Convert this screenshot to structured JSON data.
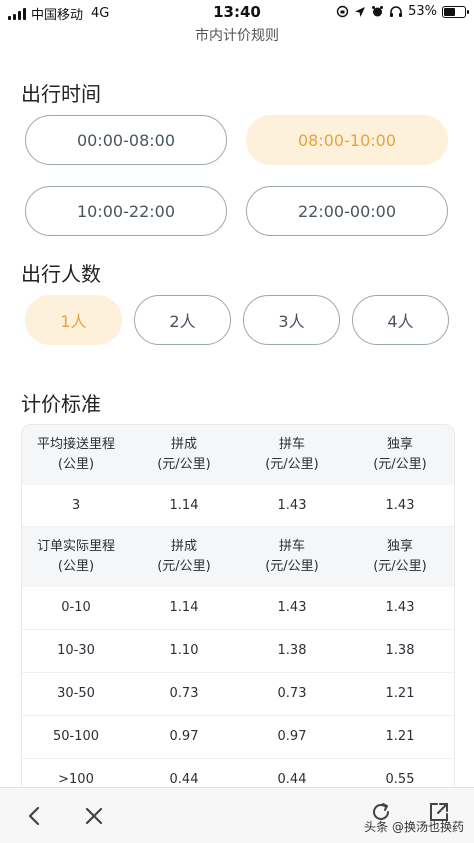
{
  "status_bar": {
    "carrier": "中国移动",
    "network": "4G",
    "time": "13:40",
    "battery": "53%",
    "battery_level": 0.53
  },
  "page": {
    "title": "市内计价规则"
  },
  "travel_time": {
    "title": "出行时间",
    "options": [
      "00:00-08:00",
      "08:00-10:00",
      "10:00-22:00",
      "22:00-00:00"
    ],
    "selected_index": 1
  },
  "passengers": {
    "title": "出行人数",
    "options": [
      "1人",
      "2人",
      "3人",
      "4人"
    ],
    "selected_index": 0
  },
  "pricing": {
    "title": "计价标准",
    "header1": [
      [
        "平均接送里程",
        "(公里)"
      ],
      [
        "拼成",
        "(元/公里)"
      ],
      [
        "拼车",
        "(元/公里)"
      ],
      [
        "独享",
        "(元/公里)"
      ]
    ],
    "row1": [
      "3",
      "1.14",
      "1.43",
      "1.43"
    ],
    "header2": [
      [
        "订单实际里程",
        "(公里)"
      ],
      [
        "拼成",
        "(元/公里)"
      ],
      [
        "拼车",
        "(元/公里)"
      ],
      [
        "独享",
        "(元/公里)"
      ]
    ],
    "rows": [
      [
        "0-10",
        "1.14",
        "1.43",
        "1.43"
      ],
      [
        "10-30",
        "1.10",
        "1.38",
        "1.38"
      ],
      [
        "30-50",
        "0.73",
        "0.73",
        "1.21"
      ],
      [
        "50-100",
        "0.97",
        "0.97",
        "1.21"
      ],
      [
        ">100",
        "0.44",
        "0.44",
        "0.55"
      ]
    ]
  },
  "bottom_bar": {
    "icons": [
      "back-icon",
      "close-icon",
      "refresh-icon",
      "share-icon"
    ],
    "watermark": "头条 @换汤也换药"
  }
}
